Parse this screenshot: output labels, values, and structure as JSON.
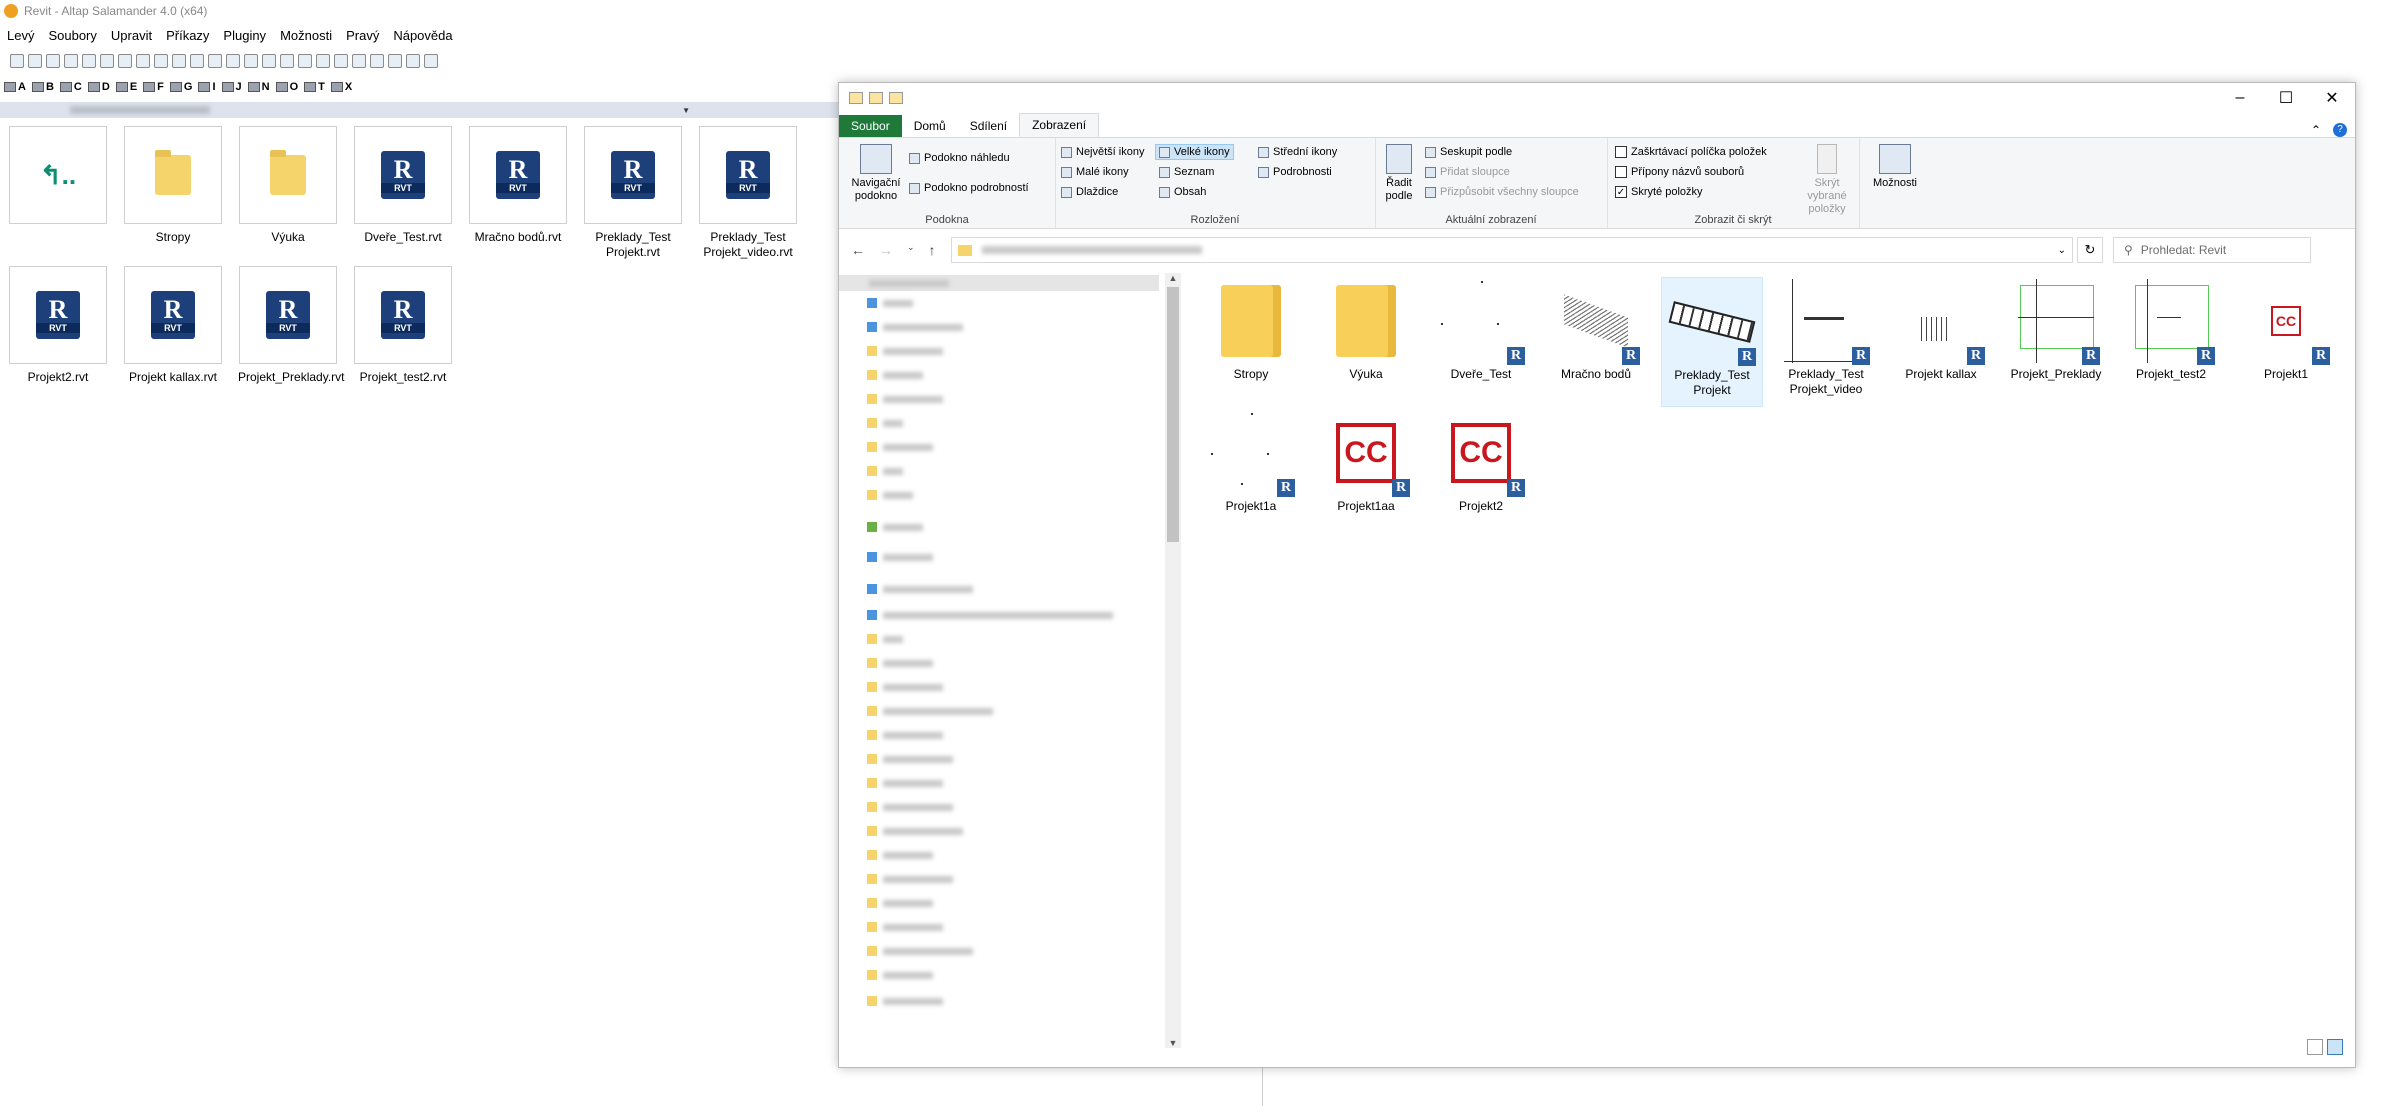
{
  "salamander": {
    "title": "Revit - Altap Salamander 4.0 (x64)",
    "menu": [
      "Levý",
      "Soubory",
      "Upravit",
      "Příkazy",
      "Pluginy",
      "Možnosti",
      "Pravý",
      "Nápověda"
    ],
    "drives": [
      "A",
      "B",
      "C",
      "D",
      "E",
      "F",
      "G",
      "I",
      "J",
      "N",
      "O",
      "T",
      "X"
    ],
    "files": [
      {
        "label": "",
        "kind": "up"
      },
      {
        "label": "Stropy",
        "kind": "folder"
      },
      {
        "label": "Výuka",
        "kind": "folder"
      },
      {
        "label": "Dveře_Test.rvt",
        "kind": "rvt"
      },
      {
        "label": "Mračno bodů.rvt",
        "kind": "rvt"
      },
      {
        "label": "Preklady_Test Projekt.rvt",
        "kind": "rvt"
      },
      {
        "label": "Preklady_Test Projekt_video.rvt",
        "kind": "rvt"
      },
      {
        "label": "Projekt2.rvt",
        "kind": "rvt"
      },
      {
        "label": "Projekt kallax.rvt",
        "kind": "rvt"
      },
      {
        "label": "Projekt_Preklady.rvt",
        "kind": "rvt"
      },
      {
        "label": "Projekt_test2.rvt",
        "kind": "rvt"
      }
    ]
  },
  "explorer": {
    "tabs": {
      "file": "Soubor",
      "home": "Domů",
      "share": "Sdílení",
      "view": "Zobrazení"
    },
    "ribbon": {
      "pane": {
        "nav": "Navigační podokno",
        "preview": "Podokno náhledu",
        "details": "Podokno podrobností",
        "label": "Podokna"
      },
      "layout": {
        "xl": "Největší ikony",
        "large": "Velké ikony",
        "medium": "Střední ikony",
        "small": "Malé ikony",
        "list": "Seznam",
        "details": "Podrobnosti",
        "tiles": "Dlaždice",
        "content": "Obsah",
        "label": "Rozložení"
      },
      "current": {
        "sort": "Řadit podle",
        "group": "Seskupit podle",
        "addcol": "Přidat sloupce",
        "fit": "Přizpůsobit všechny sloupce",
        "label": "Aktuální zobrazení"
      },
      "showhide": {
        "checkboxes": "Zaškrtávací políčka položek",
        "extensions": "Přípony názvů souborů",
        "hidden": "Skryté položky",
        "hide_selected": "Skrýt vybrané položky",
        "label": "Zobrazit či skrýt"
      },
      "options": "Možnosti"
    },
    "search_placeholder": "Prohledat: Revit",
    "items": [
      {
        "label": "Stropy",
        "kind": "folder"
      },
      {
        "label": "Výuka",
        "kind": "folder"
      },
      {
        "label": "Dveře_Test",
        "kind": "dots"
      },
      {
        "label": "Mračno bodů",
        "kind": "cloud"
      },
      {
        "label": "Preklady_Test Projekt",
        "kind": "beam",
        "selected": true
      },
      {
        "label": "Preklady_Test Projekt_video",
        "kind": "axes"
      },
      {
        "label": "Projekt kallax",
        "kind": "kallax"
      },
      {
        "label": "Projekt_Preklady",
        "kind": "green"
      },
      {
        "label": "Projekt_test2",
        "kind": "green2"
      },
      {
        "label": "Projekt1",
        "kind": "cc-small"
      },
      {
        "label": "Projekt1a",
        "kind": "dots"
      },
      {
        "label": "Projekt1aa",
        "kind": "cc"
      },
      {
        "label": "Projekt2",
        "kind": "cc"
      }
    ]
  },
  "colors": {
    "file_tab": "#1f7a3a",
    "revit": "#1d3f7a",
    "cc_red": "#c8171e",
    "folder": "#f6d46c"
  }
}
